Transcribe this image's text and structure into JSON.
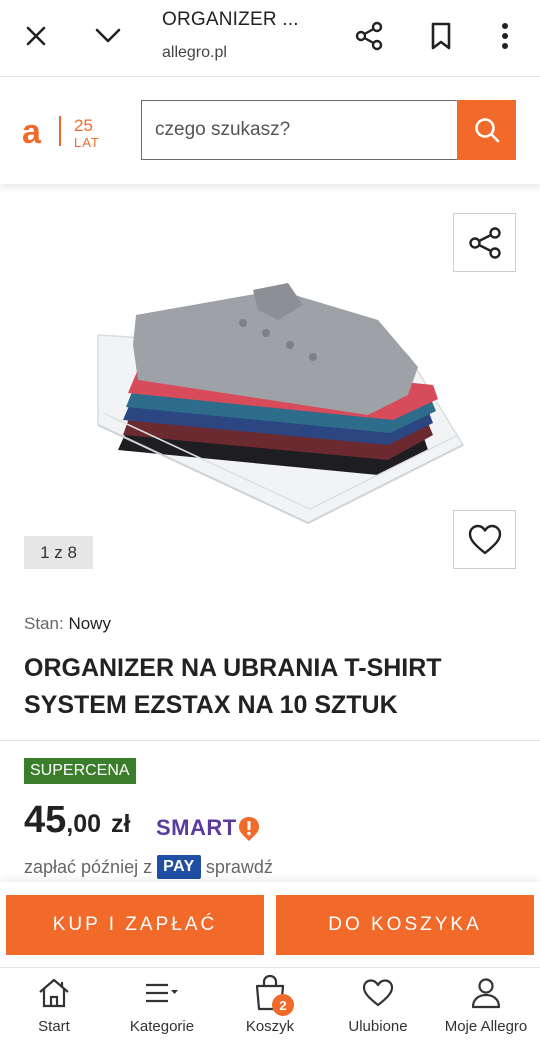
{
  "browser": {
    "title": "ORGANIZER ...",
    "url": "allegro.pl"
  },
  "header": {
    "logo_letter": "a",
    "logo_years": "25",
    "logo_lat": "LAT",
    "search_placeholder": "czego szukasz?"
  },
  "gallery": {
    "counter": "1 z 8"
  },
  "product": {
    "condition_label": "Stan:",
    "condition_value": "Nowy",
    "title": "ORGANIZER NA UBRANIA T-SHIRT SYSTEM EZSTAX NA 10 SZTUK",
    "badge": "SUPERCENA",
    "price_int": "45",
    "price_dec": ",00",
    "currency": "zł",
    "smart_label": "SMART",
    "pay_prefix": "zapłać później z",
    "pay_badge": "PAY",
    "pay_suffix": "sprawdź"
  },
  "actions": {
    "buy_label": "KUP I ZAPŁAĆ",
    "cart_label": "DO KOSZYKA"
  },
  "nav": {
    "items": [
      {
        "label": "Start",
        "icon": "home-icon"
      },
      {
        "label": "Kategorie",
        "icon": "menu-icon"
      },
      {
        "label": "Koszyk",
        "icon": "bag-icon"
      },
      {
        "label": "Ulubione",
        "icon": "heart-icon"
      },
      {
        "label": "Moje Allegro",
        "icon": "user-icon"
      }
    ],
    "cart_count": "2"
  },
  "colors": {
    "brand_orange": "#f26a2a",
    "badge_green": "#3a7d2a",
    "smart_purple": "#5b3a9e",
    "pay_blue": "#1f4ea3"
  }
}
